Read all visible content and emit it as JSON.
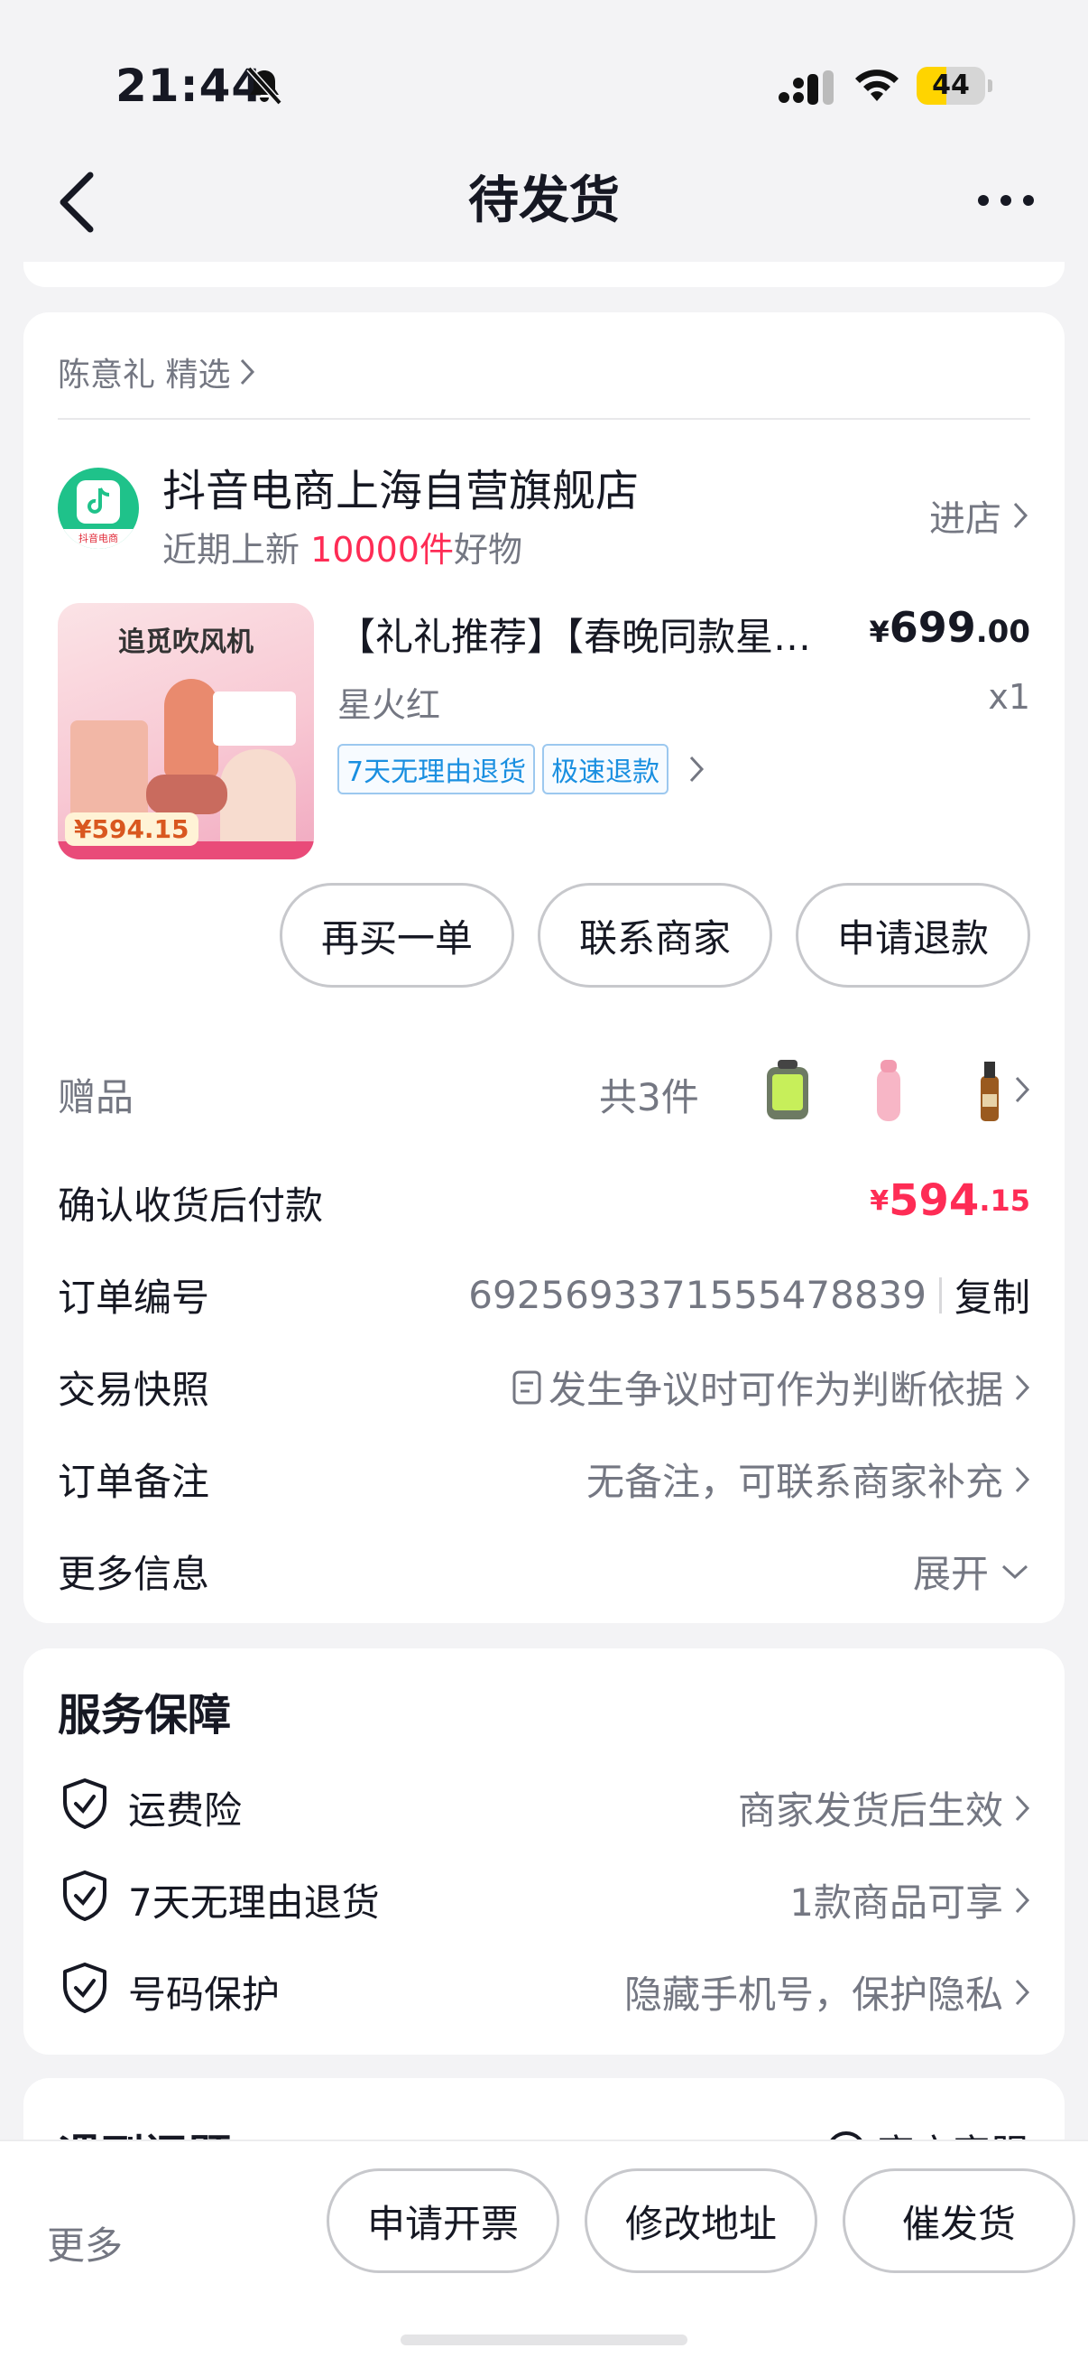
{
  "status_bar": {
    "time": "21:44",
    "battery": "44",
    "battery_level": 0.44
  },
  "nav": {
    "title": "待发货"
  },
  "order": {
    "seller_line": "陈意礼 精选",
    "shop": {
      "name": "抖音电商上海自营旗舰店",
      "logo_text": "抖音电商",
      "sub_prefix": "近期上新 ",
      "sub_highlight": "10000件",
      "sub_suffix": "好物",
      "enter_label": "进店"
    },
    "product": {
      "image_title": "追觅吹风机",
      "image_price": "¥594.15",
      "title": "【礼礼推荐】【春晚同款星火红】追觅吹风机",
      "price_currency": "¥",
      "price_int": "699",
      "price_dec": ".00",
      "spec": "星火红",
      "qty": "x1",
      "tags": [
        "7天无理由退货",
        "极速退款"
      ]
    },
    "actions": [
      "再买一单",
      "联系商家",
      "申请退款"
    ],
    "gifts": {
      "label": "赠品",
      "count": "共3件"
    },
    "rows": {
      "pay_label": "确认收货后付款",
      "pay_currency": "¥",
      "pay_int": "594",
      "pay_dec": ".15",
      "order_no_label": "订单编号",
      "order_no": "6925693371555478839",
      "copy_label": "复制",
      "snapshot_label": "交易快照",
      "snapshot_value": "发生争议时可作为判断依据",
      "note_label": "订单备注",
      "note_value": "无备注，可联系商家补充",
      "more_label": "更多信息",
      "more_value": "展开"
    }
  },
  "service": {
    "title": "服务保障",
    "items": [
      {
        "label": "运费险",
        "value": "商家发货后生效"
      },
      {
        "label": "7天无理由退货",
        "value": "1款商品可享"
      },
      {
        "label": "号码保护",
        "value": "隐藏手机号，保护隐私"
      }
    ]
  },
  "problem": {
    "title": "遇到问题",
    "cs_label": "官方客服"
  },
  "bottom_bar": {
    "more_label": "更多",
    "buttons": [
      "申请开票",
      "修改地址",
      "催发货"
    ]
  },
  "colors": {
    "accent": "#fe2c55",
    "tag_blue": "#1a8fe0",
    "logo_green": "#1fc28a"
  }
}
